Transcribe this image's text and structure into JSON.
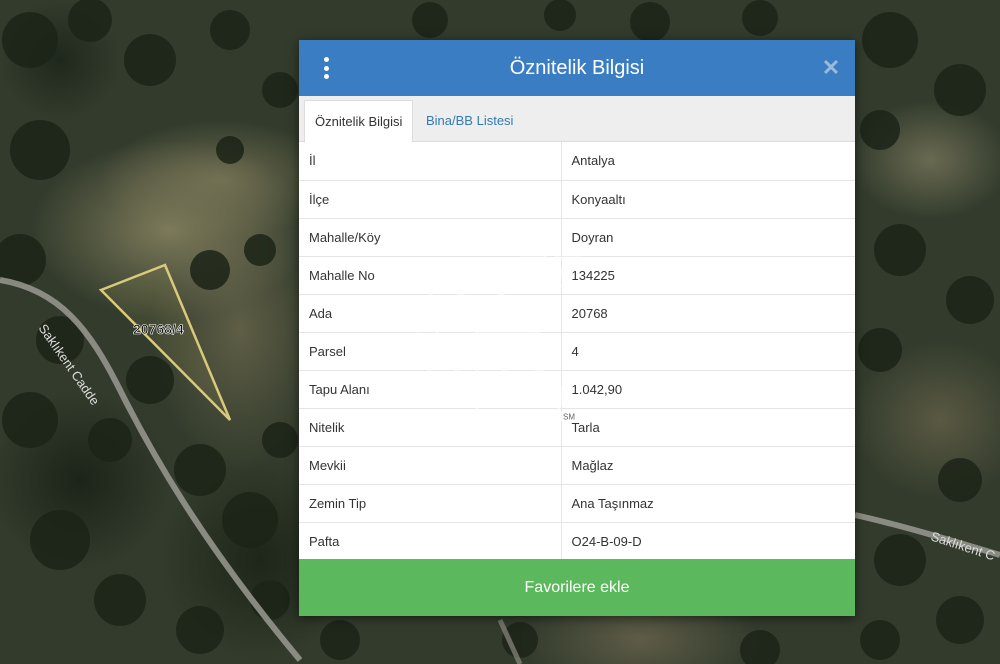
{
  "map": {
    "parcel_label": "20768/4",
    "street_label_left": "Saklıkent Cadde",
    "street_label_right": "Saklıkent C"
  },
  "dialog": {
    "title": "Öznitelik Bilgisi",
    "close_symbol": "✕",
    "tabs": [
      {
        "label": "Öznitelik Bilgisi",
        "active": true
      },
      {
        "label": "Bina/BB Listesi",
        "active": false
      }
    ],
    "rows": [
      {
        "key": "İl",
        "value": "Antalya"
      },
      {
        "key": "İlçe",
        "value": "Konyaaltı"
      },
      {
        "key": "Mahalle/Köy",
        "value": "Doyran"
      },
      {
        "key": "Mahalle No",
        "value": "134225"
      },
      {
        "key": "Ada",
        "value": "20768"
      },
      {
        "key": "Parsel",
        "value": "4"
      },
      {
        "key": "Tapu Alanı",
        "value": "1.042,90"
      },
      {
        "key": "Nitelik",
        "value": "Tarla"
      },
      {
        "key": "Mevkii",
        "value": "Mağlaz"
      },
      {
        "key": "Zemin Tip",
        "value": "Ana Taşınmaz"
      },
      {
        "key": "Pafta",
        "value": "O24-B-09-D"
      }
    ],
    "favorite_button": "Favorilere ekle"
  },
  "watermark": {
    "logo_text": "CB",
    "mark": "SM"
  },
  "colors": {
    "header": "#3a7dc2",
    "button": "#5cb85c",
    "parcel_outline": "#d9c97a"
  },
  "icons": {
    "menu": "vertical-dots-icon",
    "close": "close-icon"
  }
}
